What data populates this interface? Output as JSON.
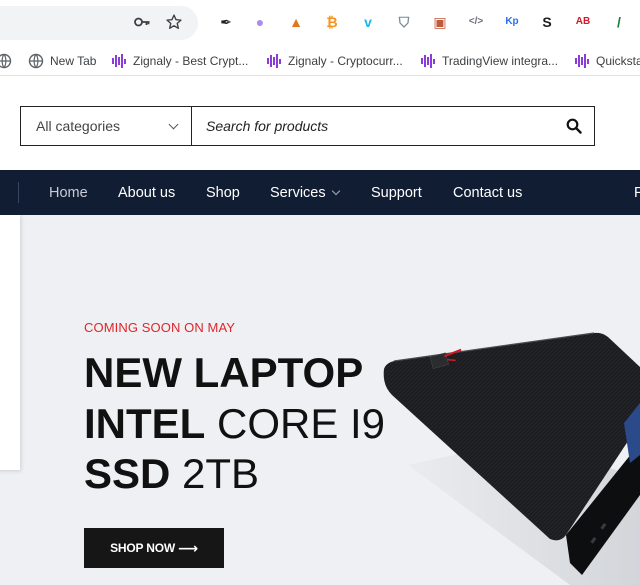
{
  "browser": {
    "omnibox_icons": [
      "key-icon",
      "bookmark-star-icon"
    ],
    "extensions": [
      {
        "name": "eyedropper-icon",
        "glyph": "✒",
        "color": "#222222"
      },
      {
        "name": "ghost-extension-icon",
        "glyph": "●",
        "color": "#a88cf0"
      },
      {
        "name": "metamask-icon",
        "glyph": "▲",
        "color": "#e2761b"
      },
      {
        "name": "bitcoin-extension-icon",
        "glyph": "₿",
        "color": "#f7931a"
      },
      {
        "name": "vimeo-icon",
        "glyph": "v",
        "color": "#1ab7ea"
      },
      {
        "name": "shield-extension-icon",
        "glyph": "⛉",
        "color": "#7a8a9a"
      },
      {
        "name": "screen-capture-icon",
        "glyph": "▣",
        "color": "#c05a3a"
      },
      {
        "name": "code-extension-icon",
        "glyph": "</>",
        "color": "#6a6f78"
      },
      {
        "name": "kp-extension-icon",
        "glyph": "Kp",
        "color": "#2a6ef0"
      },
      {
        "name": "s-extension-icon",
        "glyph": "S",
        "color": "#1c1c1c"
      },
      {
        "name": "adblock-extension-icon",
        "glyph": "AB",
        "color": "#d11a2a"
      },
      {
        "name": "terminal-extension-icon",
        "glyph": "/",
        "color": "#1e7a3a"
      }
    ]
  },
  "bookmarks": [
    {
      "label": "New Tab",
      "icon": "globe-icon"
    },
    {
      "label": "Zignaly - Best Crypt...",
      "icon": "zignaly-icon"
    },
    {
      "label": "Zignaly - Cryptocurr...",
      "icon": "zignaly-icon"
    },
    {
      "label": "TradingView integra...",
      "icon": "zignaly-icon"
    },
    {
      "label": "Quicksta",
      "icon": "zignaly-icon"
    }
  ],
  "search": {
    "category_label": "All categories",
    "placeholder": "Search for products"
  },
  "nav": {
    "items": [
      "Home",
      "About us",
      "Shop",
      "Services",
      "Support",
      "Contact us",
      "F"
    ]
  },
  "hero": {
    "eyebrow": "COMING SOON ON MAY",
    "line1_bold": "NEW LAPTOP",
    "line2_bold": "INTEL",
    "line2_light": "CORE I9",
    "line3_bold": "SSD",
    "line3_light": "2TB",
    "button_label": "SHOP NOW",
    "button_arrow": "⟶"
  },
  "colors": {
    "nav_bg": "#111d33",
    "eyebrow_red": "#e0262b",
    "hero_bg": "#eef0f3",
    "button_bg": "#161616"
  }
}
